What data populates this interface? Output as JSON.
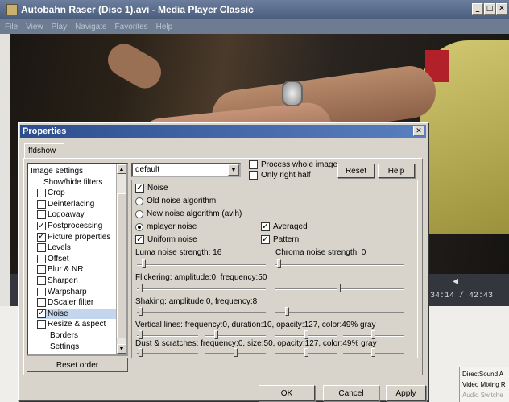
{
  "mpc": {
    "title": "Autobahn Raser (Disc 1).avi - Media Player Classic",
    "menu": [
      "File",
      "View",
      "Play",
      "Navigate",
      "Favorites",
      "Help"
    ],
    "time": "34:14 / 42:43"
  },
  "directshow": [
    "DirectSound A",
    "Video Mixing R",
    "Audio Switche"
  ],
  "dialog": {
    "title": "Properties",
    "tab": "ffdshow",
    "preset": "default",
    "process_whole_image": "Process whole image",
    "only_right_half": "Only right half",
    "reset": "Reset",
    "help": "Help",
    "reset_order": "Reset order",
    "ok": "OK",
    "cancel": "Cancel",
    "apply": "Apply"
  },
  "tree": [
    {
      "label": "Image settings",
      "cb": null,
      "indent": 0
    },
    {
      "label": "Show/hide filters",
      "cb": null,
      "indent": 2
    },
    {
      "label": "Crop",
      "cb": false,
      "indent": 1
    },
    {
      "label": "Deinterlacing",
      "cb": false,
      "indent": 1
    },
    {
      "label": "Logoaway",
      "cb": false,
      "indent": 1
    },
    {
      "label": "Postprocessing",
      "cb": true,
      "indent": 1
    },
    {
      "label": "Picture properties",
      "cb": true,
      "indent": 1
    },
    {
      "label": "Levels",
      "cb": false,
      "indent": 1
    },
    {
      "label": "Offset",
      "cb": false,
      "indent": 1
    },
    {
      "label": "Blur & NR",
      "cb": false,
      "indent": 1
    },
    {
      "label": "Sharpen",
      "cb": false,
      "indent": 1
    },
    {
      "label": "Warpsharp",
      "cb": false,
      "indent": 1
    },
    {
      "label": "DScaler filter",
      "cb": false,
      "indent": 1
    },
    {
      "label": "Noise",
      "cb": true,
      "indent": 1,
      "selected": true
    },
    {
      "label": "Resize & aspect",
      "cb": false,
      "indent": 1
    },
    {
      "label": "Borders",
      "cb": null,
      "indent": 3
    },
    {
      "label": "Settings",
      "cb": null,
      "indent": 3
    }
  ],
  "noise": {
    "enable": "Noise",
    "old_alg": "Old noise algorithm",
    "new_alg": "New noise algorithm (avih)",
    "mplayer": "mplayer noise",
    "averaged": "Averaged",
    "uniform": "Uniform noise",
    "pattern": "Pattern",
    "luma": "Luma noise strength: 16",
    "chroma": "Chroma noise strength: 0",
    "flicker": "Flickering: amplitude:0, frequency:50",
    "shaking": "Shaking: amplitude:0, frequency:8",
    "vlines": "Vertical lines: frequency:0, duration:10, opacity:127, color:49% gray",
    "dust": "Dust & scratches: frequency:0, size:50, opacity:127, color:49% gray"
  }
}
